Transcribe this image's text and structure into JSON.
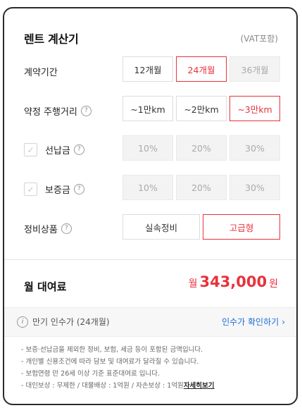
{
  "header": {
    "title": "렌트 계산기",
    "vat_note": "(VAT포함)"
  },
  "contract_period": {
    "label": "계약기간",
    "options": [
      "12개월",
      "24개월",
      "36개월"
    ],
    "selected": "24개월",
    "disabled": [
      "36개월"
    ]
  },
  "mileage": {
    "label": "약정 주행거리",
    "options": [
      "~1만km",
      "~2만km",
      "~3만km"
    ],
    "selected": "~3만km"
  },
  "prepayment": {
    "label": "선납금",
    "checked": false,
    "options": [
      "10%",
      "20%",
      "30%"
    ]
  },
  "deposit": {
    "label": "보증금",
    "checked": false,
    "options": [
      "10%",
      "20%",
      "30%"
    ]
  },
  "maintenance": {
    "label": "정비상품",
    "options": [
      "실속정비",
      "고급형"
    ],
    "selected": "고급형"
  },
  "fee": {
    "label": "월 대여료",
    "prefix": "월",
    "amount": "343,000",
    "suffix": "원"
  },
  "buyout": {
    "info_text": "만기 인수가 (24개월)",
    "link_text": "인수가 확인하기"
  },
  "notes": {
    "lines": [
      "- 보증·선납금을 제외한 정비, 보험, 세금 등이 포함된 금액입니다.",
      "- 개인별 신용조건에 따라 담보 및 대여료가 달라질 수 있습니다.",
      "- 보험연령 만 26세 이상 기준 표준대여료 입니다."
    ],
    "last_line": "- 대인보상 : 무제한 / 대물배상 : 1억원 / 자손보상 : 1억원",
    "more_link": "자세히보기"
  },
  "colors": {
    "accent": "#e8323c",
    "link": "#1a6fd8"
  }
}
